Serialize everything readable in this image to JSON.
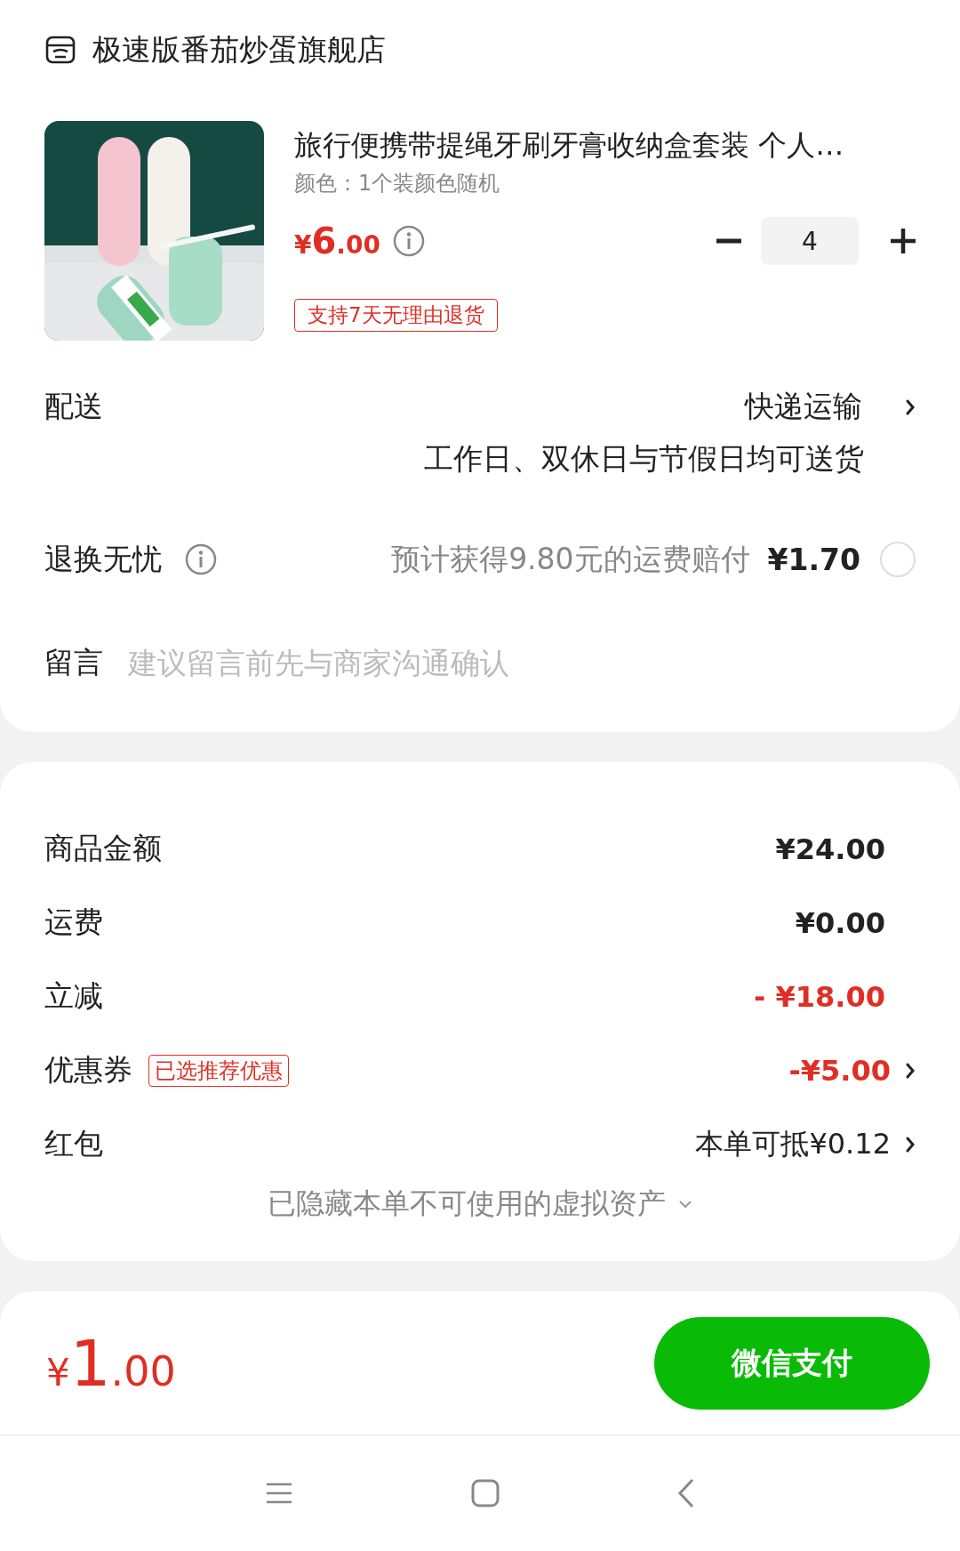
{
  "store": {
    "name": "极速版番茄炒蛋旗舰店"
  },
  "product": {
    "title": "旅行便携带提绳牙刷牙膏收纳盒套装 个人…",
    "variant": "颜色：1个装颜色随机",
    "price": {
      "currency": "¥",
      "integer": "6",
      "decimal": ".00"
    },
    "quantity": "4",
    "tag": "支持7天无理由退货"
  },
  "delivery": {
    "label": "配送",
    "method": "快递运输",
    "note": "工作日、双休日与节假日均可送货"
  },
  "return_insurance": {
    "label": "退换无忧",
    "description": "预计获得9.80元的运费赔付",
    "price": "¥1.70",
    "selected": false
  },
  "message": {
    "label": "留言",
    "placeholder": "建议留言前先与商家沟通确认"
  },
  "summary": {
    "rows": [
      {
        "label": "商品金额",
        "value": "¥24.00",
        "highlight": false,
        "chevron": false
      },
      {
        "label": "运费",
        "value": "¥0.00",
        "highlight": false,
        "chevron": false
      },
      {
        "label": "立减",
        "value": "- ¥18.00",
        "highlight": true,
        "chevron": false
      },
      {
        "label": "优惠券",
        "badge": "已选推荐优惠",
        "value": "-¥5.00",
        "highlight": true,
        "chevron": true
      },
      {
        "label": "红包",
        "value": "本单可抵¥0.12",
        "highlight": false,
        "chevron": true
      }
    ],
    "hidden_note": "已隐藏本单不可使用的虚拟资产"
  },
  "total": {
    "currency": "¥",
    "integer": "1",
    "decimal": ".00"
  },
  "pay_button": "微信支付"
}
